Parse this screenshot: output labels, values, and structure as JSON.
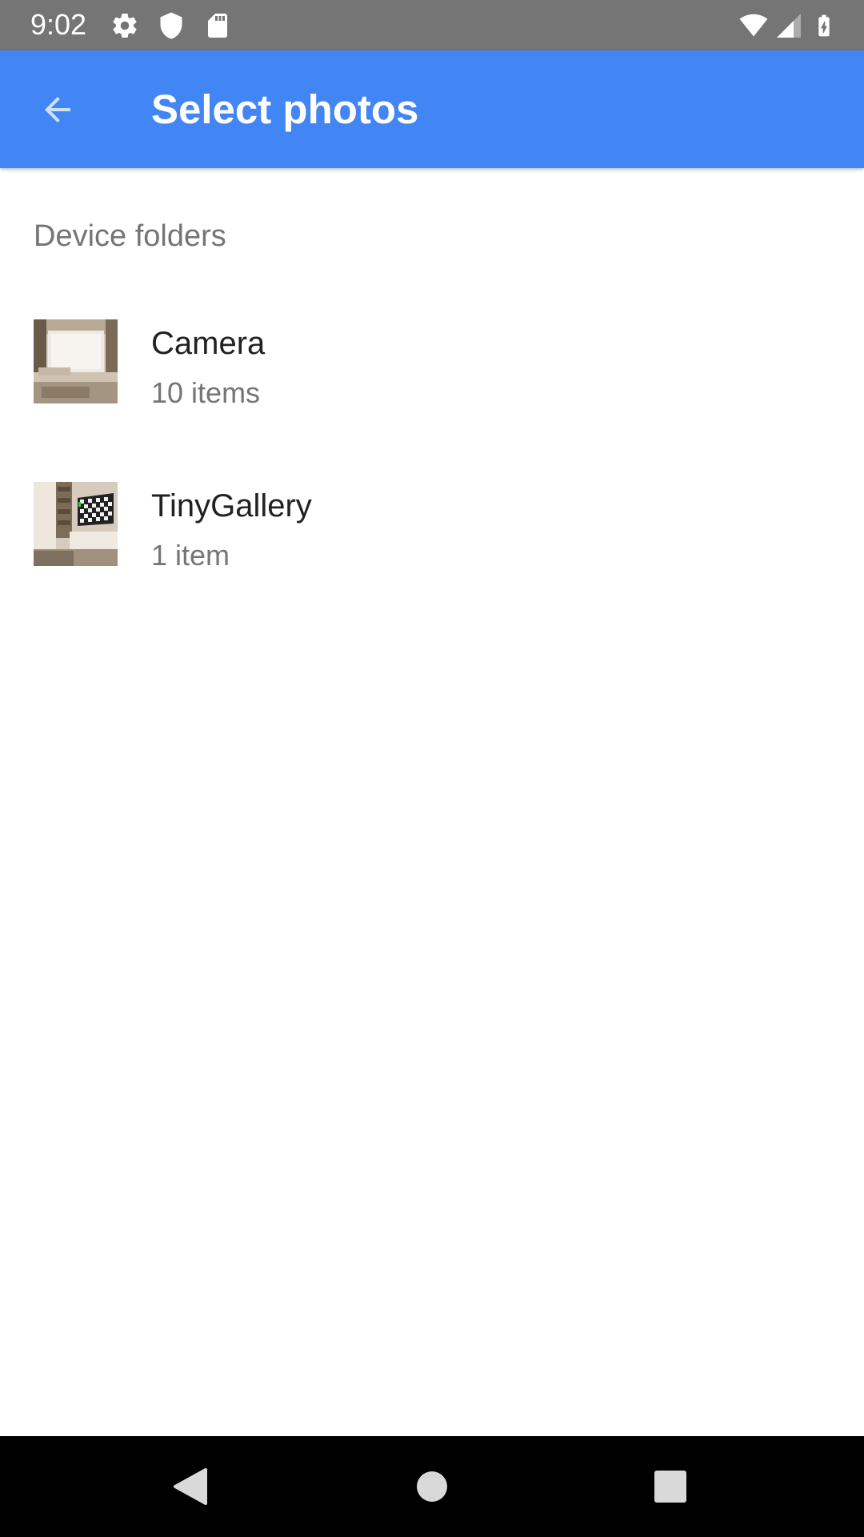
{
  "status_bar": {
    "time": "9:02",
    "icons_left": [
      "settings-icon",
      "shield-icon",
      "sd-card-icon"
    ],
    "icons_right": [
      "wifi-icon",
      "cell-signal-icon",
      "battery-charging-icon"
    ]
  },
  "app_bar": {
    "title": "Select photos",
    "back_icon": "arrow-back-icon",
    "background": "#4285f4"
  },
  "section": {
    "header": "Device folders"
  },
  "folders": [
    {
      "name": "Camera",
      "count": "10 items"
    },
    {
      "name": "TinyGallery",
      "count": "1 item"
    }
  ],
  "nav_bar": {
    "buttons": [
      "back-triangle-icon",
      "home-circle-icon",
      "recents-square-icon"
    ]
  }
}
